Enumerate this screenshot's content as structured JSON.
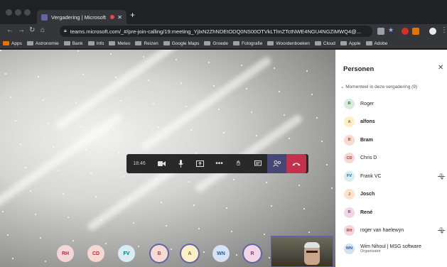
{
  "browser": {
    "tab_title": "Vergadering | Microsoft Te",
    "new_tab": "+",
    "url_host": "teams.microsoft.com",
    "url_path": "/_#/pre-join-calling/19:meeting_YjIxN2ZhNDEtODQ0NS00OTVkLTlmZTctNWE4NGU4NGZiMWQ4@...",
    "bookmarks": [
      "Apps",
      "Astronomie",
      "Bank",
      "Info",
      "Meteo",
      "Reizen",
      "Google Maps",
      "Groede",
      "Fotografie",
      "Woordenboeken",
      "Cloud",
      "Apple",
      "Adobe"
    ]
  },
  "call": {
    "timer": "18:46",
    "controls": [
      "camera",
      "microphone",
      "share",
      "more",
      "raise-hand",
      "chat",
      "participants",
      "hang-up"
    ]
  },
  "stage_avatars": [
    {
      "initials": "RH",
      "bg": "#f3d6d8",
      "fg": "#a4373a"
    },
    {
      "initials": "CD",
      "bg": "#f6d7d2",
      "fg": "#a4373a"
    },
    {
      "initials": "FV",
      "bg": "#d9ecf1",
      "fg": "#0b6a86"
    },
    {
      "initials": "B",
      "bg": "#f6dad3",
      "fg": "#b4492e"
    },
    {
      "initials": "A",
      "bg": "#fcefc7",
      "fg": "#8a6d1a"
    },
    {
      "initials": "WN",
      "bg": "#d5e2f4",
      "fg": "#235d9f"
    },
    {
      "initials": "R",
      "bg": "#f0d6e7",
      "fg": "#8b3a70"
    }
  ],
  "panel": {
    "title": "Personen",
    "section": "Momenteel in deze vergadering (9)",
    "people": [
      {
        "initials": "R",
        "name": "Roger",
        "bold": false,
        "muted": false,
        "bg": "#d9ebdd",
        "fg": "#2e6b3a"
      },
      {
        "initials": "A",
        "name": "alfons",
        "bold": true,
        "muted": false,
        "bg": "#fcefc7",
        "fg": "#8a6d1a"
      },
      {
        "initials": "B",
        "name": "Bram",
        "bold": true,
        "muted": false,
        "bg": "#f6dad3",
        "fg": "#b4492e"
      },
      {
        "initials": "CD",
        "name": "Chris D",
        "bold": false,
        "muted": false,
        "bg": "#f6d7d2",
        "fg": "#a4373a"
      },
      {
        "initials": "FV",
        "name": "Frank VC",
        "bold": false,
        "muted": true,
        "bg": "#d9ecf1",
        "fg": "#0b6a86"
      },
      {
        "initials": "J",
        "name": "Josch",
        "bold": true,
        "muted": false,
        "bg": "#fde3c9",
        "fg": "#a0581e"
      },
      {
        "initials": "R",
        "name": "René",
        "bold": true,
        "muted": false,
        "bg": "#f0d6e7",
        "fg": "#8b3a70"
      },
      {
        "initials": "RH",
        "name": "roger van haelewyn",
        "bold": false,
        "muted": true,
        "bg": "#f3d6d8",
        "fg": "#a4373a"
      },
      {
        "initials": "WN",
        "name": "Wim Nihoul | MSG software",
        "sub": "Organisator",
        "bold": false,
        "muted": false,
        "bg": "#d5e2f4",
        "fg": "#235d9f"
      }
    ]
  }
}
